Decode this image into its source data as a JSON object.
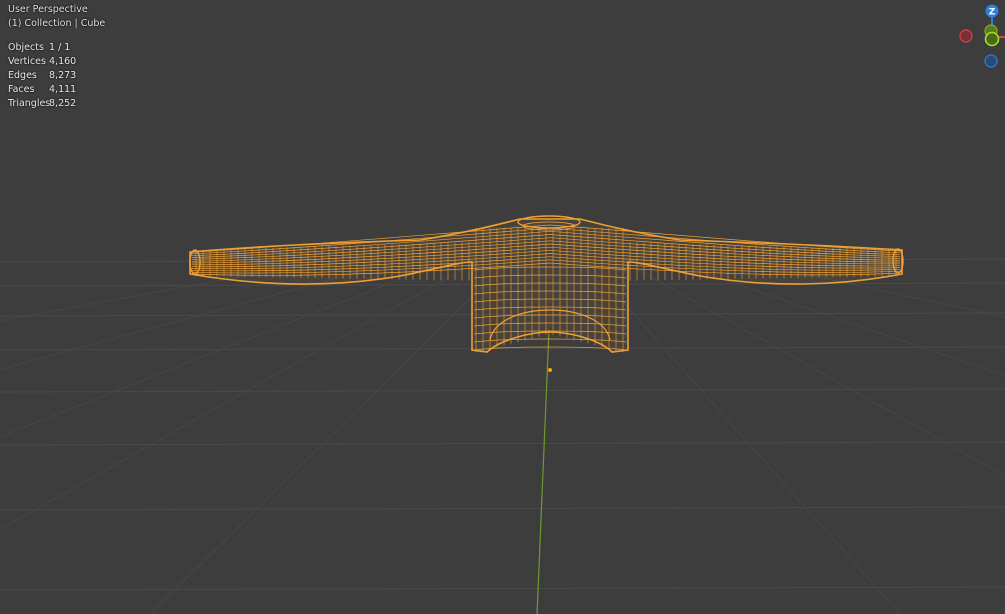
{
  "viewport": {
    "view_name": "User Perspective",
    "collection_line": "(1) Collection | Cube"
  },
  "stats": [
    {
      "label": "Objects",
      "value": "1 / 1"
    },
    {
      "label": "Vertices",
      "value": "4,160"
    },
    {
      "label": "Edges",
      "value": "8,273"
    },
    {
      "label": "Faces",
      "value": "4,111"
    },
    {
      "label": "Triangles",
      "value": "8,252"
    }
  ],
  "gizmo": {
    "z_label": "Z",
    "colors": {
      "x": "#d9434b",
      "y": "#7fb31a",
      "z": "#2f7fdc"
    }
  },
  "colors": {
    "background": "#3d3d3d",
    "grid": "#4a4a4a",
    "mesh_wire": "#f0a033",
    "y_axis_line": "#6f9a30",
    "origin": "#ffa500"
  }
}
